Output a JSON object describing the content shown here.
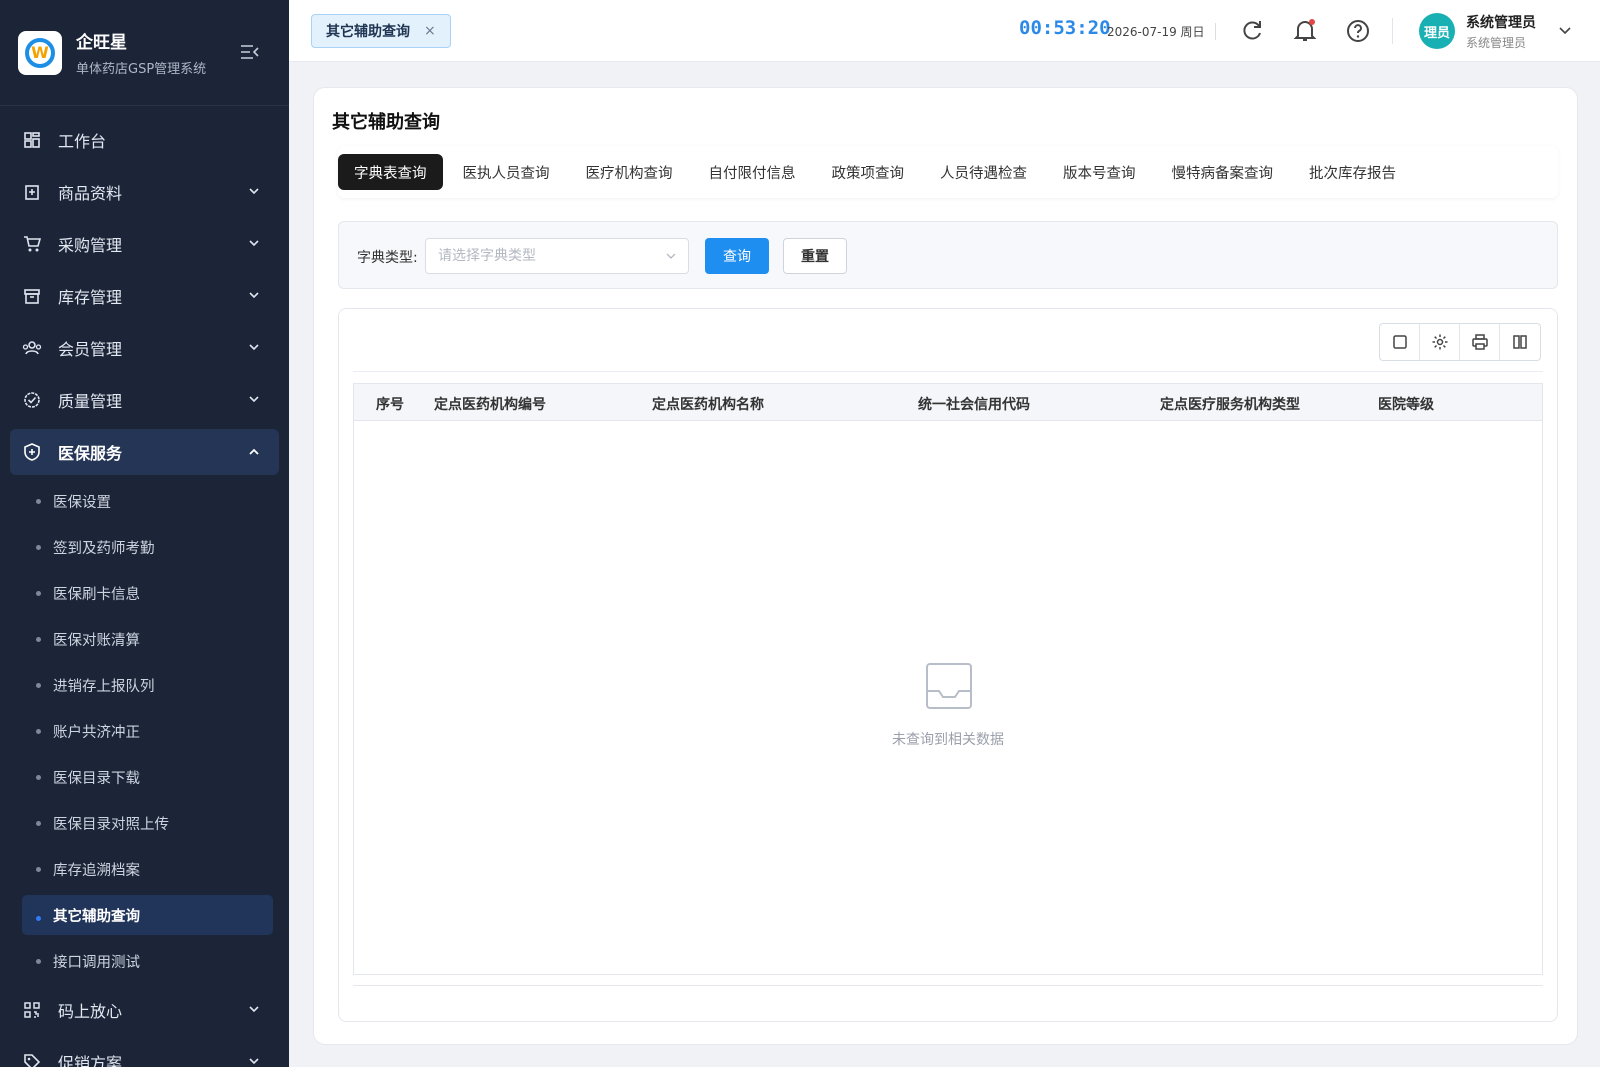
{
  "brand": {
    "name": "企旺星",
    "subtitle": "单体药店GSP管理系统",
    "logo_letter": "W"
  },
  "sidebar": {
    "items": [
      {
        "label": "工作台",
        "icon": "dashboard-icon"
      },
      {
        "label": "商品资料",
        "icon": "goods-icon"
      },
      {
        "label": "采购管理",
        "icon": "cart-icon"
      },
      {
        "label": "库存管理",
        "icon": "inventory-icon"
      },
      {
        "label": "会员管理",
        "icon": "members-icon"
      },
      {
        "label": "质量管理",
        "icon": "quality-icon"
      },
      {
        "label": "医保服务",
        "icon": "shield-icon"
      },
      {
        "label": "码上放心",
        "icon": "qrcode-icon"
      },
      {
        "label": "促销方案",
        "icon": "tag-icon"
      }
    ],
    "subitems": [
      "医保设置",
      "签到及药师考勤",
      "医保刷卡信息",
      "医保对账清算",
      "进销存上报队列",
      "账户共济冲正",
      "医保目录下载",
      "医保目录对照上传",
      "库存追溯档案",
      "其它辅助查询",
      "接口调用测试"
    ]
  },
  "topbar": {
    "tab_label": "其它辅助查询",
    "tab_close": "×",
    "time": "00:53:20",
    "date": "2026-07-19 周日",
    "avatar_text": "理员",
    "user_name": "系统管理员",
    "user_role": "系统管理员"
  },
  "page": {
    "title": "其它辅助查询",
    "tabs": [
      "字典表查询",
      "医执人员查询",
      "医疗机构查询",
      "自付限付信息",
      "政策项查询",
      "人员待遇检查",
      "版本号查询",
      "慢特病备案查询",
      "批次库存报告"
    ],
    "filter_label": "字典类型:",
    "select_placeholder": "请选择字典类型",
    "query_button": "查询",
    "reset_button": "重置",
    "columns": [
      "序号",
      "定点医药机构编号",
      "定点医药机构名称",
      "统一社会信用代码",
      "定点医疗服务机构类型",
      "医院等级"
    ],
    "empty_text": "未查询到相关数据"
  },
  "colors": {
    "sidebar_bg": "#1c2538",
    "accent": "#1e8ef0",
    "active_tab": "#1b1b1b"
  }
}
